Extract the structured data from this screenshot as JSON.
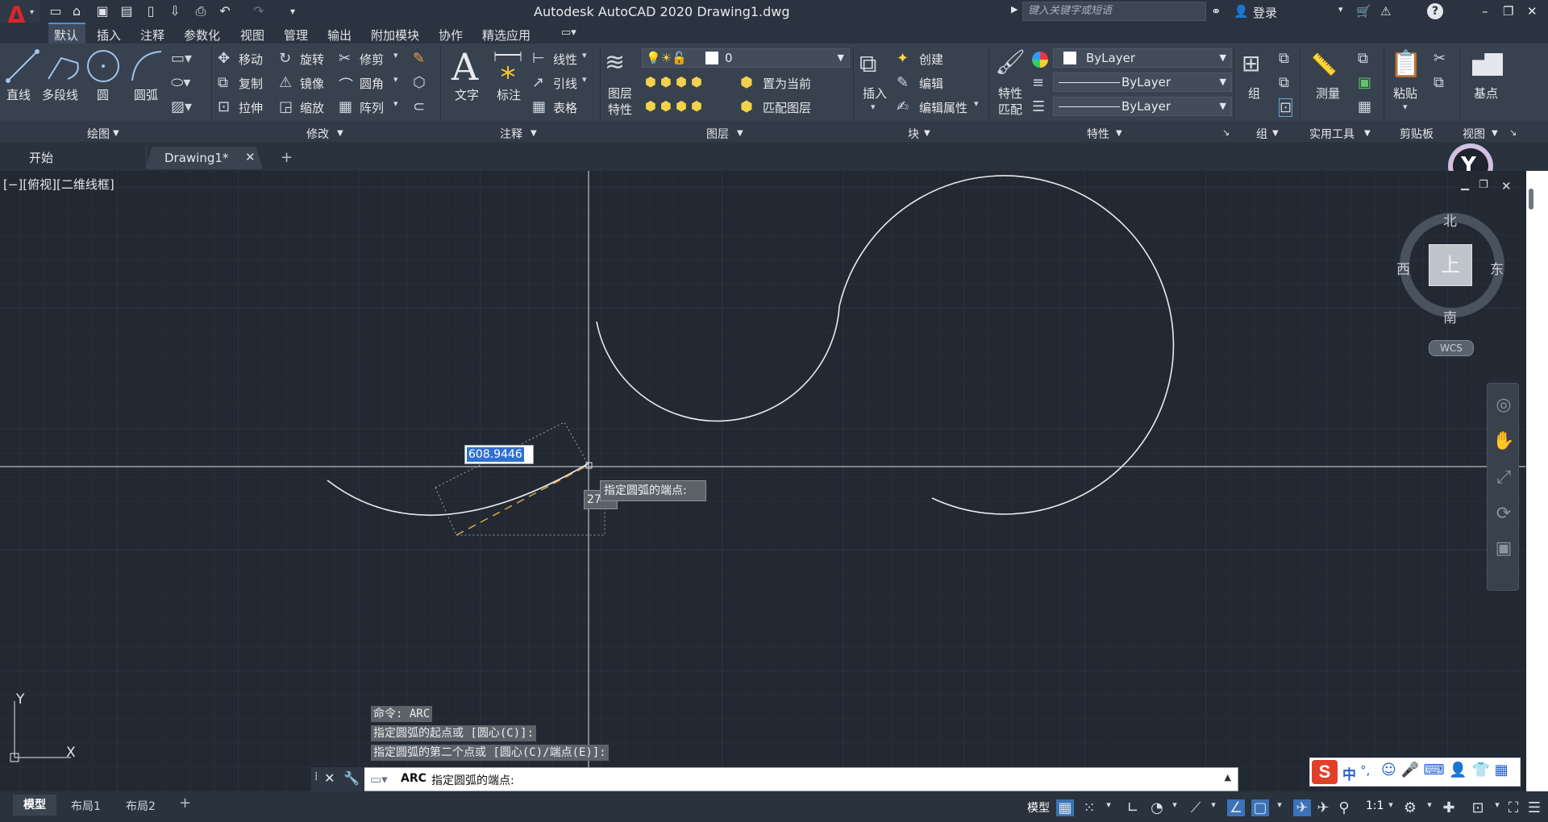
{
  "app": {
    "title": "Autodesk AutoCAD 2020    Drawing1.dwg",
    "search_placeholder": "键入关键字或短语",
    "login_label": "登录",
    "help_icon": "?"
  },
  "menu": [
    "默认",
    "插入",
    "注释",
    "参数化",
    "视图",
    "管理",
    "输出",
    "附加模块",
    "协作",
    "精选应用"
  ],
  "ribbon": {
    "draw": {
      "title": "绘图",
      "line": "直线",
      "polyline": "多段线",
      "circle": "圆",
      "arc": "圆弧"
    },
    "modify": {
      "title": "修改",
      "move": "移动",
      "rotate": "旋转",
      "trim": "修剪",
      "copy": "复制",
      "mirror": "镜像",
      "fillet": "圆角",
      "stretch": "拉伸",
      "scale": "缩放",
      "array": "阵列"
    },
    "annotation": {
      "title": "注释",
      "text": "文字",
      "dim": "标注",
      "linear": "线性",
      "leader": "引线",
      "table": "表格"
    },
    "layers": {
      "title": "图层",
      "props_line1": "图层",
      "props_line2": "特性",
      "layer_value": "0",
      "set_current": "置为当前",
      "match_layer": "匹配图层"
    },
    "block": {
      "title": "块",
      "insert": "插入",
      "create": "创建",
      "edit": "编辑",
      "edit_attr": "编辑属性"
    },
    "properties": {
      "title": "特性",
      "match_line1": "特性",
      "match_line2": "匹配",
      "color": "ByLayer",
      "linetype": "ByLayer",
      "lineweight": "ByLayer"
    },
    "groups": {
      "title": "组",
      "group": "组"
    },
    "utilities": {
      "title": "实用工具",
      "measure": "测量"
    },
    "clipboard": {
      "title": "剪贴板",
      "paste": "粘贴"
    },
    "view": {
      "title": "视图",
      "base": "基点"
    }
  },
  "tabs": {
    "start": "开始",
    "drawing": "Drawing1*"
  },
  "viewport": {
    "label": "[−][俯视][二维线框]",
    "dyn_input": "608.9446",
    "angle_partial": "27",
    "tooltip": "指定圆弧的端点:",
    "viewcube": {
      "north": "北",
      "south": "南",
      "east": "东",
      "west": "西",
      "face": "上",
      "wcs": "WCS"
    },
    "ucs": {
      "y": "Y",
      "x": "X"
    }
  },
  "command": {
    "history": [
      "命令: ARC",
      "指定圆弧的起点或 [圆心(C)]:",
      "指定圆弧的第二个点或 [圆心(C)/端点(E)]:"
    ],
    "name": "ARC",
    "prompt": "指定圆弧的端点:"
  },
  "layout_tabs": [
    "模型",
    "布局1",
    "布局2"
  ],
  "status": {
    "model": "模型",
    "scale": "1:1"
  },
  "ime": {
    "lang": "中",
    "punct": "°,"
  }
}
